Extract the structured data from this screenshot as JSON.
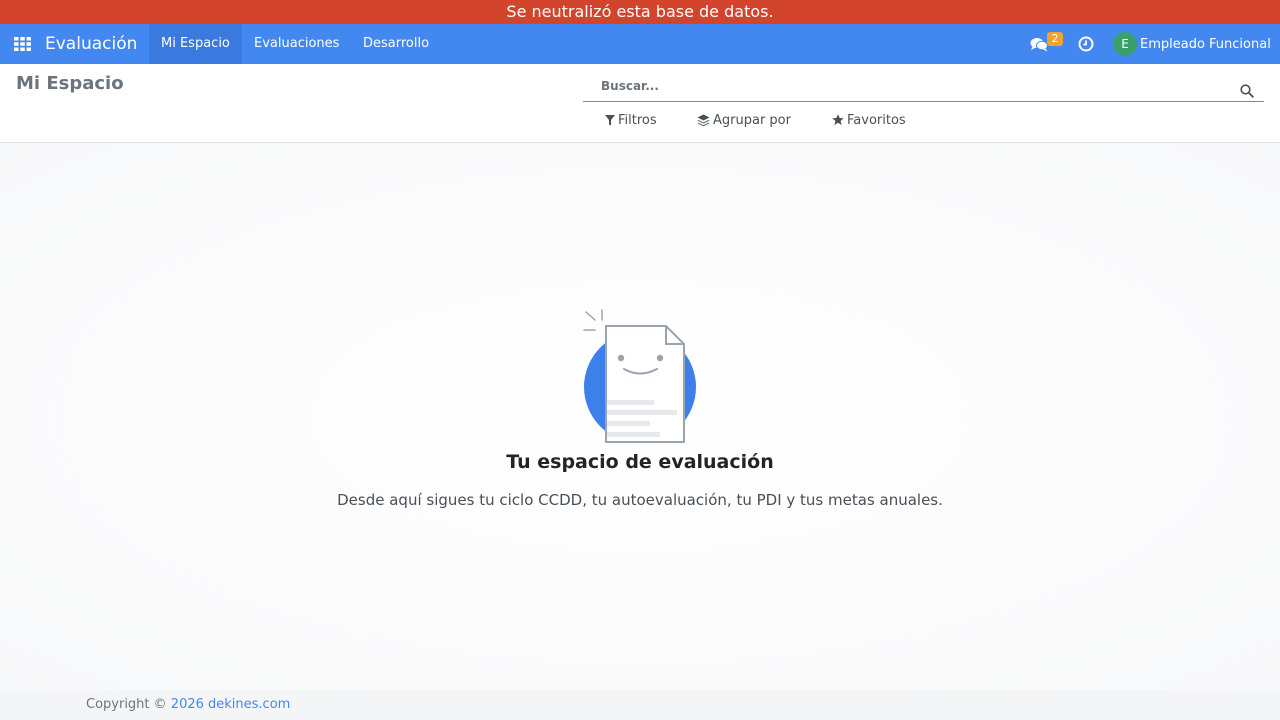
{
  "banner": {
    "text": "Se neutralizó esta base de datos."
  },
  "navbar": {
    "app_name": "Evaluación",
    "menu": [
      {
        "label": "Mi Espacio",
        "active": true
      },
      {
        "label": "Evaluaciones",
        "active": false
      },
      {
        "label": "Desarrollo",
        "active": false
      }
    ],
    "icons": {
      "apps": "grid-icon",
      "chat": "chat-icon",
      "activity": "clock-icon"
    },
    "chat_badge": "2",
    "user": {
      "initial": "E",
      "name": "Empleado Funcional"
    }
  },
  "control_panel": {
    "title": "Mi Espacio",
    "search": {
      "placeholder": "Buscar..."
    },
    "filters_label": "Filtros",
    "group_by_label": "Agrupar por",
    "favorites_label": "Favoritos"
  },
  "help": {
    "title": "Tu espacio de evaluación",
    "text": "Desde aquí sigues tu ciclo CCDD, tu autoevaluación, tu PDI y tus metas anuales."
  },
  "footer": {
    "prefix": "Copyright © ",
    "link": "2026 dekines.com"
  },
  "colors": {
    "banner": "#d3442c",
    "navbar": "#4387f0",
    "navbar_active": "#3a79dd",
    "badge": "#f0a32e",
    "avatar": "#3aa06a"
  }
}
